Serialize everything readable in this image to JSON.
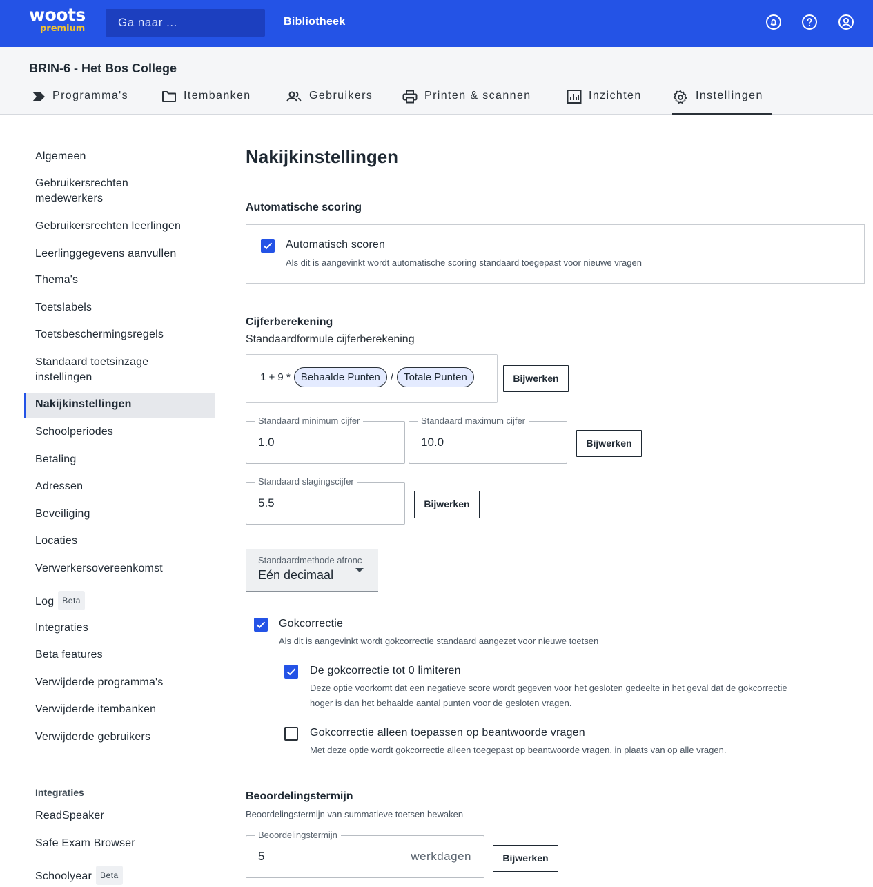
{
  "brand": {
    "logo_top": "woots",
    "logo_bottom": "premium"
  },
  "topbar": {
    "search_placeholder": "Ga naar ...",
    "library_link": "Bibliotheek"
  },
  "org": {
    "name": "BRIN-6 - Het Bos College"
  },
  "tabs": [
    {
      "label": "Programma's"
    },
    {
      "label": "Itembanken"
    },
    {
      "label": "Gebruikers"
    },
    {
      "label": "Printen & scannen"
    },
    {
      "label": "Inzichten"
    },
    {
      "label": "Instellingen"
    }
  ],
  "sidebar": {
    "items": [
      {
        "label": "Algemeen"
      },
      {
        "label": "Gebruikersrechten medewerkers"
      },
      {
        "label": "Gebruikersrechten leerlingen"
      },
      {
        "label": "Leerlinggegevens aanvullen"
      },
      {
        "label": "Thema's"
      },
      {
        "label": "Toetslabels"
      },
      {
        "label": "Toetsbeschermingsregels"
      },
      {
        "label": "Standaard toetsinzage instellingen"
      },
      {
        "label": "Nakijkinstellingen"
      },
      {
        "label": "Schoolperiodes"
      },
      {
        "label": "Betaling"
      },
      {
        "label": "Adressen"
      },
      {
        "label": "Beveiliging"
      },
      {
        "label": "Locaties"
      },
      {
        "label": "Verwerkersovereenkomst"
      },
      {
        "label": "Log",
        "badge": "Beta"
      },
      {
        "label": "Integraties"
      },
      {
        "label": "Beta features"
      },
      {
        "label": "Verwijderde programma's"
      },
      {
        "label": "Verwijderde itembanken"
      },
      {
        "label": "Verwijderde gebruikers"
      }
    ],
    "integrations_heading": "Integraties",
    "integrations": [
      {
        "label": "ReadSpeaker"
      },
      {
        "label": "Safe Exam Browser"
      },
      {
        "label": "Schoolyear",
        "badge": "Beta"
      }
    ]
  },
  "main": {
    "title": "Nakijkinstellingen",
    "auto_scoring": {
      "heading": "Automatische scoring",
      "checkbox_label": "Automatisch scoren",
      "checked": true,
      "description": "Als dit is aangevinkt wordt automatische scoring standaard toegepast voor nieuwe vragen"
    },
    "grading": {
      "heading": "Cijferberekening",
      "subheading": "Standaardformule cijferberekening",
      "formula_prefix": "1 + 9 *",
      "chip1": "Behaalde Punten",
      "operator": "/",
      "chip2": "Totale Punten",
      "update": "Bijwerken",
      "min_label": "Standaard minimum cijfer",
      "min_value": "1.0",
      "max_label": "Standaard maximum cijfer",
      "max_value": "10.0",
      "pass_label": "Standaard slagingscijfer",
      "pass_value": "5.5",
      "rounding_label": "Standaardmethode afronc",
      "rounding_value": "Eén decimaal"
    },
    "guess": {
      "label": "Gokcorrectie",
      "checked": true,
      "description": "Als dit is aangevinkt wordt gokcorrectie standaard aangezet voor nieuwe toetsen",
      "limit_label": "De gokcorrectie tot 0 limiteren",
      "limit_checked": true,
      "limit_desc_1": "Deze optie voorkomt dat een negatieve score wordt gegeven voor het gesloten gedeelte in het geval dat de gokcorrectie",
      "limit_desc_2": "hoger is dan het behaalde aantal punten voor de gesloten vragen.",
      "answered_label": "Gokcorrectie alleen toepassen op beantwoorde vragen",
      "answered_checked": false,
      "answered_desc": "Met deze optie wordt gokcorrectie alleen toegepast op beantwoorde vragen, in plaats van op alle vragen."
    },
    "term": {
      "heading": "Beoordelingstermijn",
      "description": "Beoordelingstermijn van summatieve toetsen bewaken",
      "field_label": "Beoordelingstermijn",
      "value": "5",
      "unit": "werkdagen"
    }
  },
  "colors": {
    "primary": "#2453e6",
    "logo_accent": "#f4c430",
    "active_bg": "#e6e8ec"
  }
}
